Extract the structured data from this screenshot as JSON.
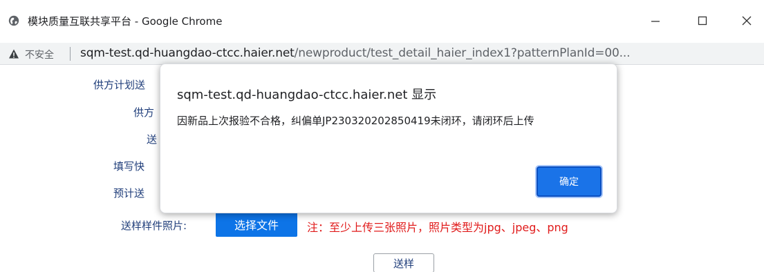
{
  "window": {
    "title": "模块质量互联共享平台 - Google Chrome"
  },
  "address_bar": {
    "security_label": "不安全",
    "url_host": "sqm-test.qd-huangdao-ctcc.haier.net",
    "url_path": "/newproduct/test_detail_haier_index1?patternPlanId=00..."
  },
  "form": {
    "labels": [
      "供方计划送",
      "供方",
      "送",
      "填写快",
      "预计送"
    ],
    "photo_label": "送样样件照片:",
    "upload_button": "选择文件",
    "upload_note": "注：至少上传三张照片，照片类型为jpg、jpeg、png",
    "submit_button": "送样"
  },
  "dialog": {
    "title": "sqm-test.qd-huangdao-ctcc.haier.net 显示",
    "message": "因新品上次报验不合格，纠偏单JP230320202850419未闭环，请闭环后上传",
    "ok_button": "确定"
  },
  "colors": {
    "accent": "#1a73e8",
    "label_text": "#1f3d7a",
    "warning_text": "#e01a1a"
  },
  "icons": {
    "tab": "globe-icon",
    "security": "warning-triangle-icon"
  }
}
